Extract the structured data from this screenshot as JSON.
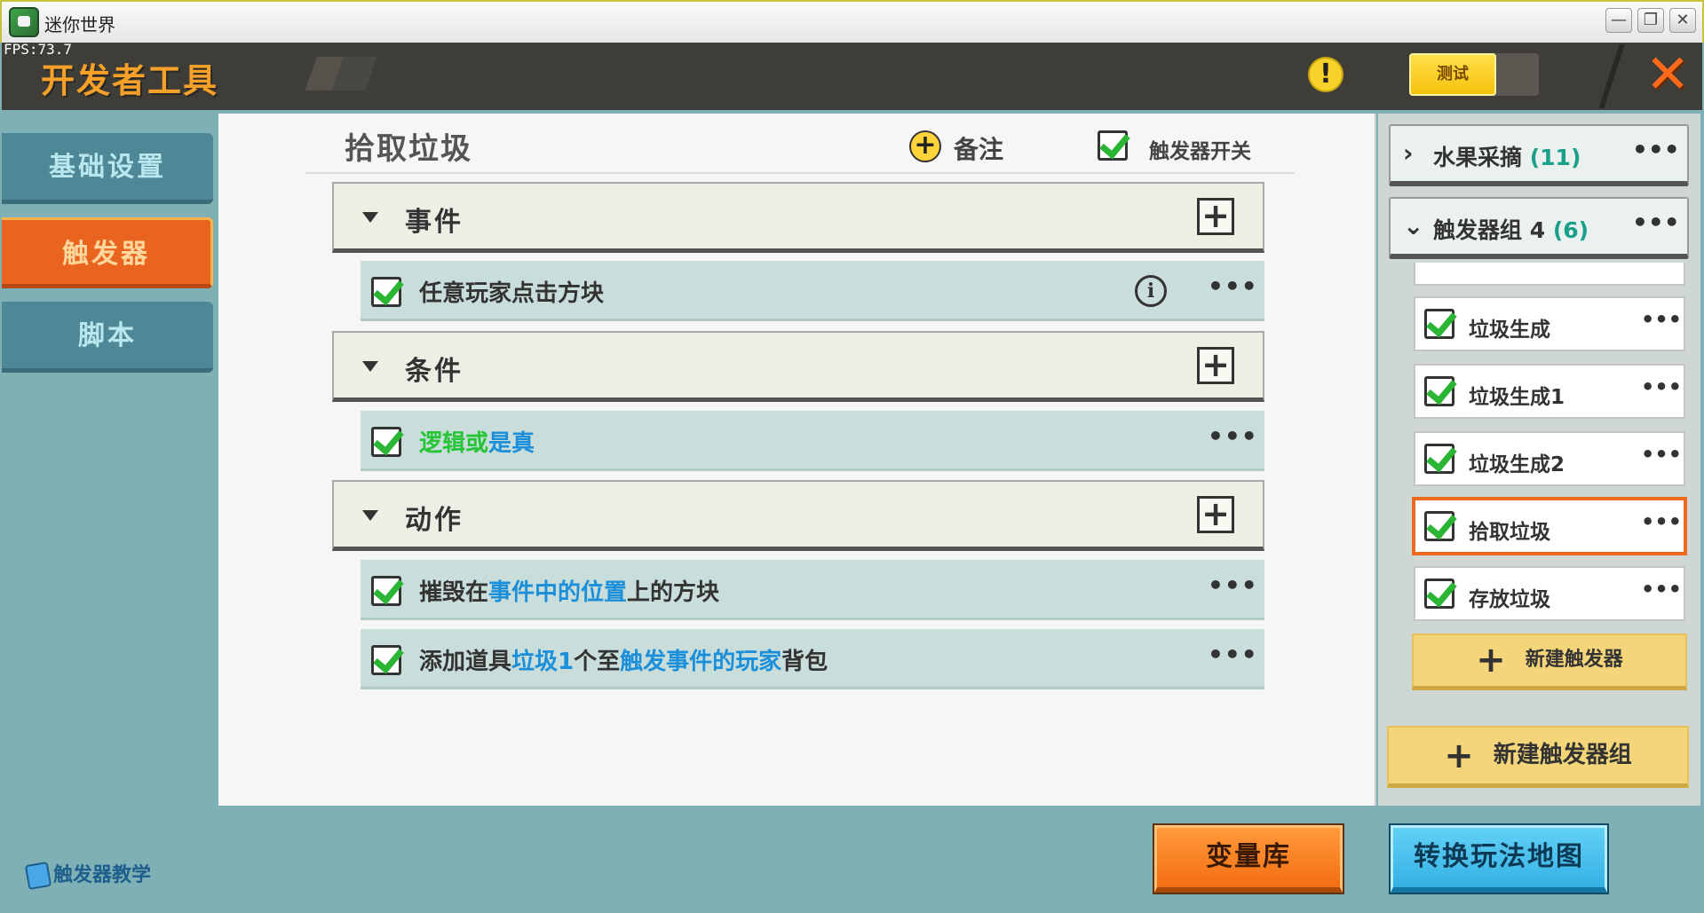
{
  "window": {
    "title": "迷你世界",
    "minimize": "—",
    "restore": "❐",
    "close": "✕"
  },
  "header": {
    "fps": "FPS:73.7",
    "title": "开发者工具",
    "warning": "!",
    "test_label": "测试",
    "close": "✕"
  },
  "sidebar": {
    "items": [
      {
        "label": "基础设置",
        "active": false
      },
      {
        "label": "触发器",
        "active": true
      },
      {
        "label": "脚本",
        "active": false
      }
    ],
    "tutorial": "触发器教学"
  },
  "trigger": {
    "title": "拾取垃圾",
    "note_label": "备注",
    "switch_label": "触发器开关",
    "sections": {
      "event": {
        "label": "事件"
      },
      "condition": {
        "label": "条件"
      },
      "action": {
        "label": "动作"
      }
    },
    "event_rows": [
      {
        "parts": [
          "任意玩家点击方块"
        ]
      }
    ],
    "condition_rows": [
      {
        "parts": [
          "逻辑或",
          "是真"
        ]
      }
    ],
    "action_rows": [
      {
        "parts": [
          "摧毁在",
          "事件中的位置",
          "上的方块"
        ]
      },
      {
        "parts": [
          "添加道具",
          "垃圾1",
          "个至",
          "触发事件的玩家",
          "背包"
        ]
      }
    ],
    "more": "•••",
    "info": "i",
    "add": "+"
  },
  "groups": [
    {
      "name": "水果采摘",
      "count": "(11)",
      "expanded": false,
      "chevron": "›"
    },
    {
      "name": "触发器组 4",
      "count": "(6)",
      "expanded": true,
      "chevron": "⌄"
    }
  ],
  "triggers": [
    {
      "label": "垃圾生成",
      "selected": false
    },
    {
      "label": "垃圾生成1",
      "selected": false
    },
    {
      "label": "垃圾生成2",
      "selected": false
    },
    {
      "label": "拾取垃圾",
      "selected": true
    },
    {
      "label": "存放垃圾",
      "selected": false
    }
  ],
  "new_trigger": "新建触发器",
  "new_group": "新建触发器组",
  "bottom": {
    "variables": "变量库",
    "convert": "转换玩法地图"
  },
  "colors": {
    "accent_orange": "#e9651f",
    "link_blue": "#1b8fd9",
    "logic_green": "#26c437",
    "count_teal": "#1aa08a"
  }
}
